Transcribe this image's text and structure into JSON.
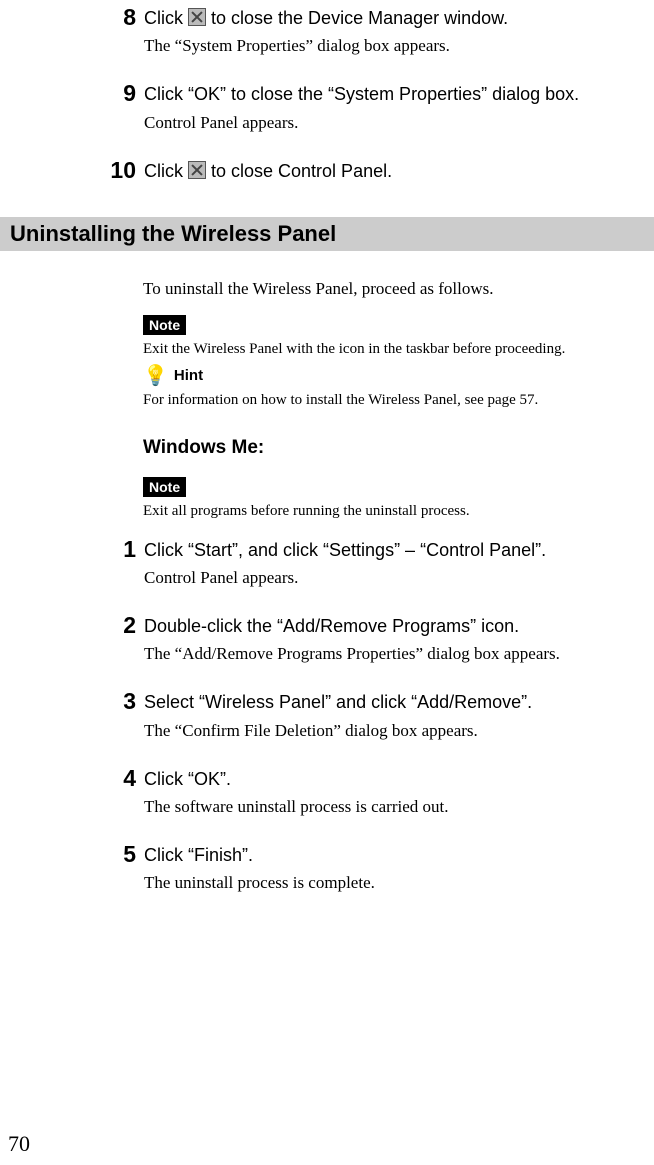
{
  "topSteps": [
    {
      "num": "8",
      "instruction_before": "Click ",
      "instruction_after": " to close the Device Manager window.",
      "has_icon": true,
      "result": "The “System Properties” dialog box appears."
    },
    {
      "num": "9",
      "instruction_before": "Click “OK” to close the “System Properties” dialog box.",
      "instruction_after": "",
      "has_icon": false,
      "result": "Control Panel appears."
    },
    {
      "num": "10",
      "instruction_before": "Click ",
      "instruction_after": " to close Control Panel.",
      "has_icon": true,
      "result": ""
    }
  ],
  "sectionHeading": "Uninstalling the Wireless Panel",
  "intro": "To uninstall the Wireless Panel, proceed as follows.",
  "noteLabel": "Note",
  "note1": "Exit the Wireless Panel with the icon in the taskbar before proceeding.",
  "hintLabel": "Hint",
  "hintText": "For information on how to install the Wireless Panel, see page 57.",
  "subHeading": "Windows Me:",
  "note2": "Exit all programs before running the uninstall process.",
  "bottomSteps": [
    {
      "num": "1",
      "instruction": "Click “Start”, and click “Settings” – “Control Panel”.",
      "result": "Control Panel appears."
    },
    {
      "num": "2",
      "instruction": "Double-click the “Add/Remove Programs” icon.",
      "result": "The “Add/Remove Programs Properties” dialog box appears."
    },
    {
      "num": "3",
      "instruction": "Select “Wireless Panel” and click “Add/Remove”.",
      "result": "The “Confirm File Deletion” dialog box appears."
    },
    {
      "num": "4",
      "instruction": "Click “OK”.",
      "result": "The software uninstall process is carried out."
    },
    {
      "num": "5",
      "instruction": "Click “Finish”.",
      "result": "The uninstall process is complete."
    }
  ],
  "pageNumber": "70"
}
